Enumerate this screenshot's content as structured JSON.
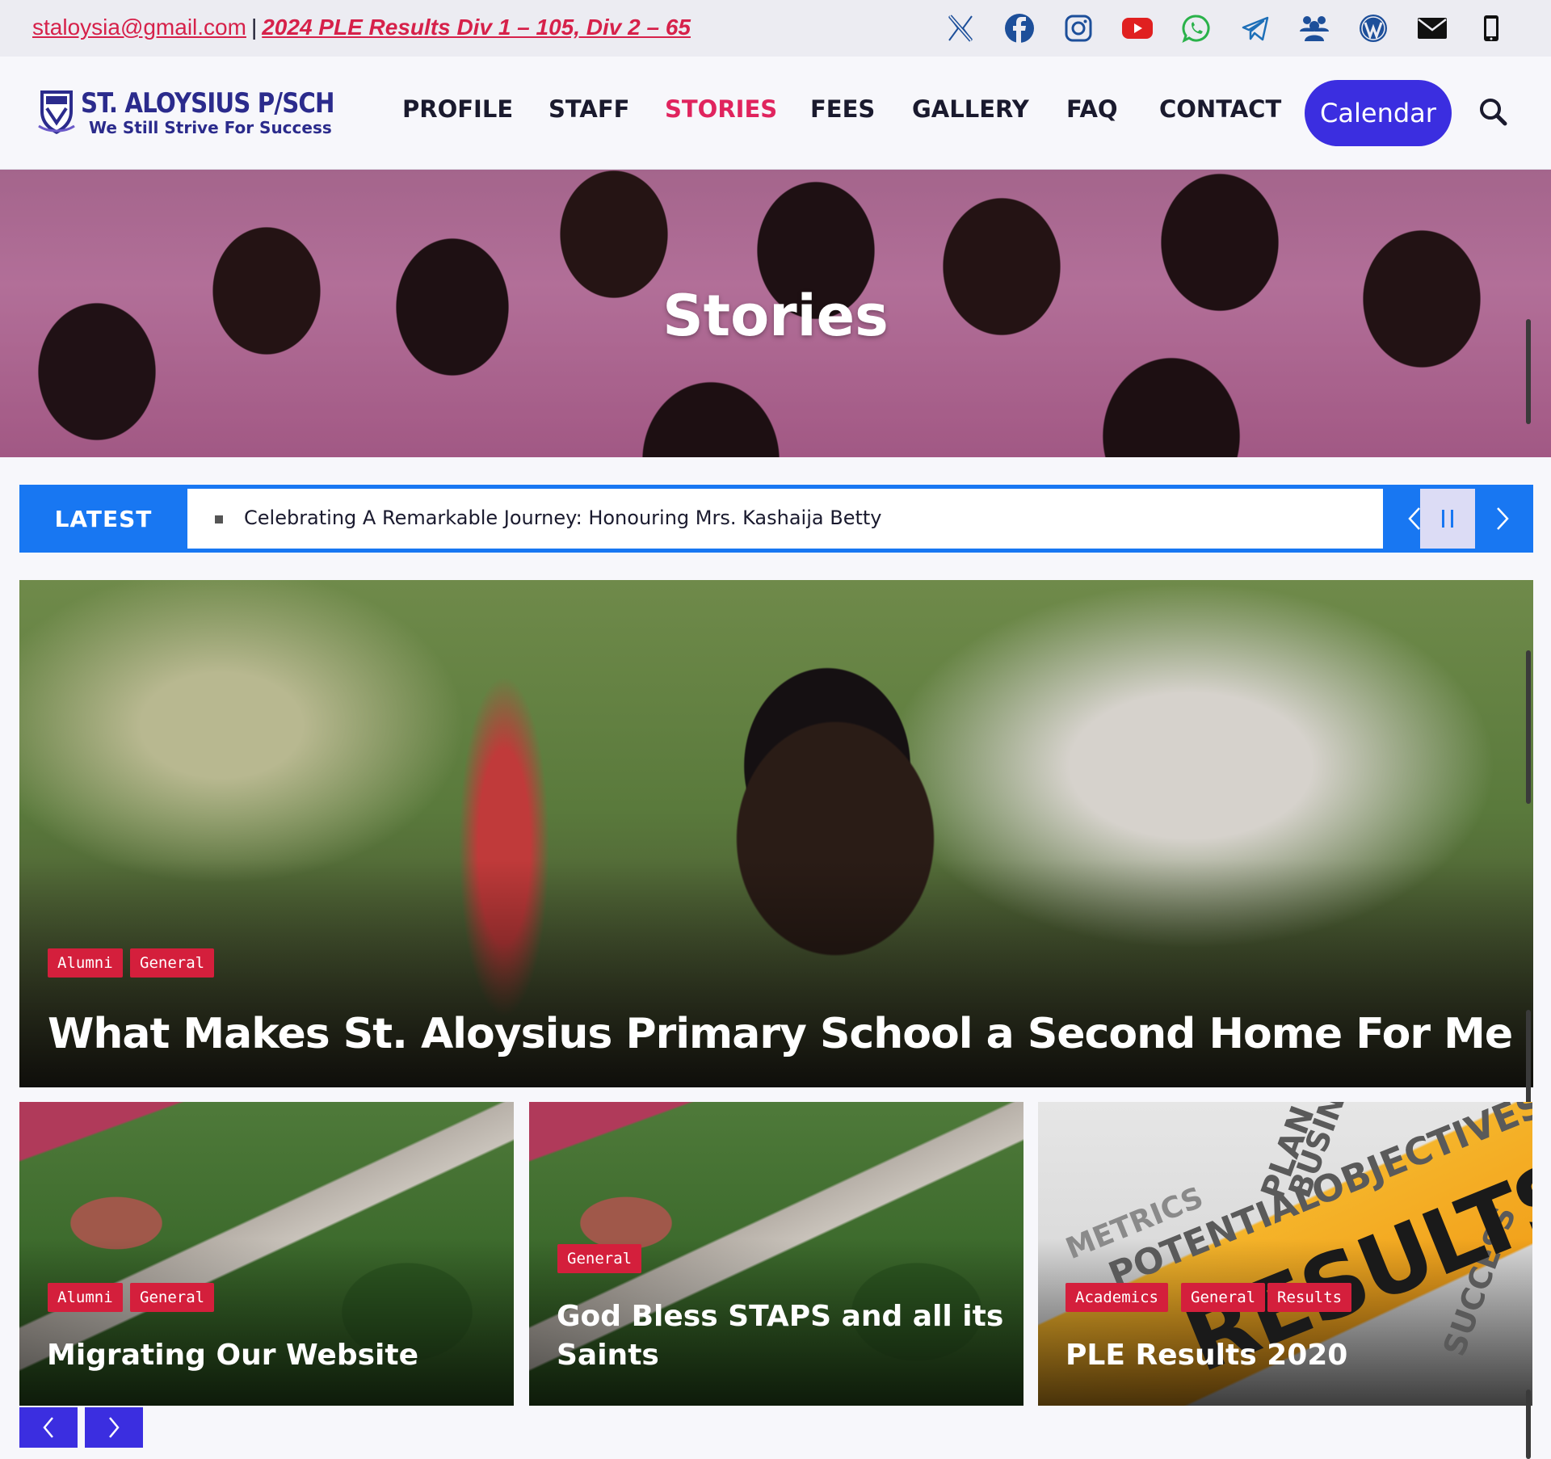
{
  "topbar": {
    "email": "staloysia@gmail.com",
    "separator": "|",
    "announcement": "2024 PLE Results Div 1 – 105, Div 2 – 65",
    "social_icons": [
      "x-icon",
      "facebook-icon",
      "instagram-icon",
      "youtube-icon",
      "whatsapp-icon",
      "telegram-icon",
      "community-icon",
      "wordpress-icon",
      "mail-icon",
      "phone-icon"
    ]
  },
  "header": {
    "logo_title": "ST. ALOYSIUS P/SCH",
    "logo_tagline": "We Still Strive For Success",
    "nav": [
      {
        "label": "PROFILE"
      },
      {
        "label": "STAFF"
      },
      {
        "label": "STORIES",
        "active": true
      },
      {
        "label": "FEES"
      },
      {
        "label": "GALLERY"
      },
      {
        "label": "FAQ"
      },
      {
        "label": "CONTACT"
      }
    ],
    "calendar_button": "Calendar",
    "accent_color": "#3b2ee0",
    "active_color": "#e0245e"
  },
  "hero": {
    "title": "Stories"
  },
  "ticker": {
    "label": "LATEST",
    "headline": "Celebrating A Remarkable Journey: Honouring Mrs. Kashaija Betty",
    "color": "#1877f2"
  },
  "featured": {
    "categories": [
      "Alumni",
      "General"
    ],
    "title": "What Makes St. Aloysius Primary School a Second Home For Me"
  },
  "cards": [
    {
      "categories": [
        "Alumni",
        "General"
      ],
      "title": "Migrating Our Website"
    },
    {
      "categories": [
        "General"
      ],
      "title_lines": [
        "God Bless STAPS and all its",
        "Saints"
      ]
    },
    {
      "categories": [
        "Academics",
        "General",
        "Results"
      ],
      "title": "PLE Results 2020",
      "image_words": {
        "main": "RESULTS",
        "w1": "OBJECTIVES",
        "w2": "POTENTIAL",
        "w3": "PLAN",
        "w4": "METRICS",
        "w5": "SUCCESS",
        "w6": "BUSINE"
      }
    }
  ],
  "badge_color": "#d41f3c"
}
